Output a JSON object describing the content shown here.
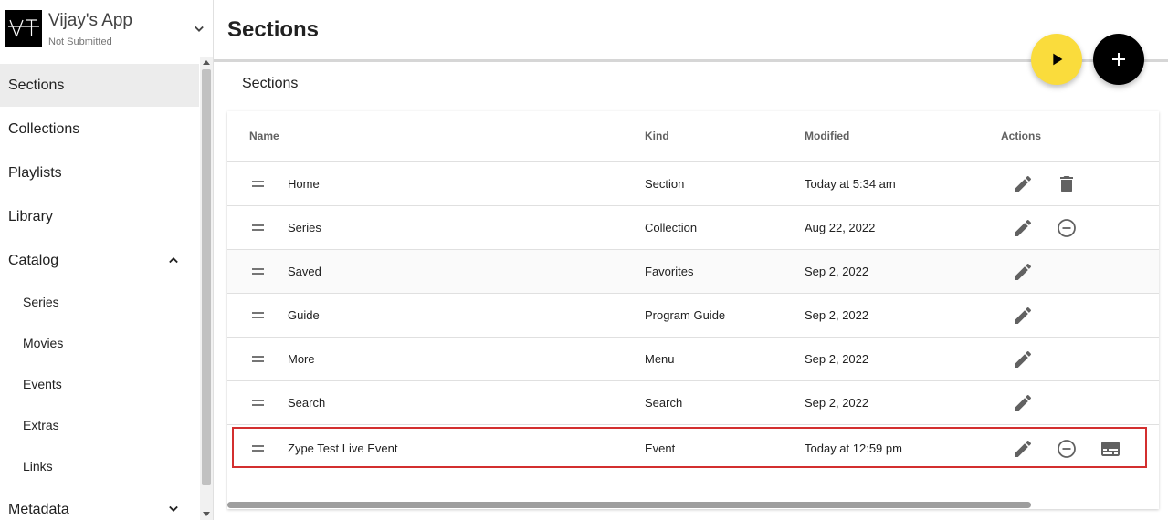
{
  "app": {
    "name": "Vijay's App",
    "status": "Not Submitted",
    "logo_text": "VT"
  },
  "sidebar": {
    "items": [
      {
        "label": "Sections",
        "active": true
      },
      {
        "label": "Collections"
      },
      {
        "label": "Playlists"
      },
      {
        "label": "Library"
      },
      {
        "label": "Catalog",
        "expanded": true
      },
      {
        "label": "Metadata",
        "expanded": false
      }
    ],
    "catalog_children": [
      "Series",
      "Movies",
      "Events",
      "Extras",
      "Links"
    ]
  },
  "page": {
    "title": "Sections",
    "section_heading": "Sections"
  },
  "table": {
    "headers": {
      "name": "Name",
      "kind": "Kind",
      "modified": "Modified",
      "actions": "Actions"
    },
    "rows": [
      {
        "name": "Home",
        "kind": "Section",
        "modified": "Today at 5:34 am",
        "actions": [
          "edit",
          "delete"
        ]
      },
      {
        "name": "Series",
        "kind": "Collection",
        "modified": "Aug 22, 2022",
        "actions": [
          "edit",
          "remove"
        ]
      },
      {
        "name": "Saved",
        "kind": "Favorites",
        "modified": "Sep 2, 2022",
        "actions": [
          "edit"
        ]
      },
      {
        "name": "Guide",
        "kind": "Program Guide",
        "modified": "Sep 2, 2022",
        "actions": [
          "edit"
        ]
      },
      {
        "name": "More",
        "kind": "Menu",
        "modified": "Sep 2, 2022",
        "actions": [
          "edit"
        ]
      },
      {
        "name": "Search",
        "kind": "Search",
        "modified": "Sep 2, 2022",
        "actions": [
          "edit"
        ]
      },
      {
        "name": "Zype Test Live Event",
        "kind": "Event",
        "modified": "Today at 12:59 pm",
        "actions": [
          "edit",
          "remove",
          "subtitles"
        ],
        "highlighted": true
      }
    ]
  },
  "colors": {
    "play_fab": "#fadc3c",
    "add_fab": "#000000",
    "highlight_border": "#d32f2f",
    "active_nav_bg": "#ececec",
    "icon_gray": "#616161"
  }
}
